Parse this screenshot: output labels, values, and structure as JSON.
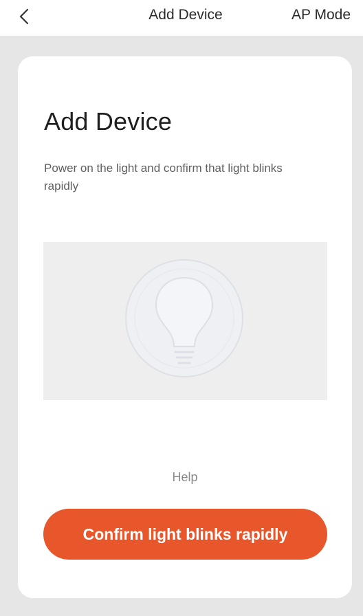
{
  "nav": {
    "title": "Add Device",
    "right_action": "AP Mode",
    "back_icon": "chevron-left-icon"
  },
  "card": {
    "title": "Add Device",
    "description": "Power on the light and confirm that light blinks  rapidly",
    "illustration_icon": "light-bulb-icon",
    "help_label": "Help",
    "confirm_label": "Confirm light blinks rapidly"
  },
  "colors": {
    "accent": "#e7572b",
    "background": "#e6e6e6",
    "card": "#ffffff",
    "illustration_bg": "#eeeeee"
  }
}
